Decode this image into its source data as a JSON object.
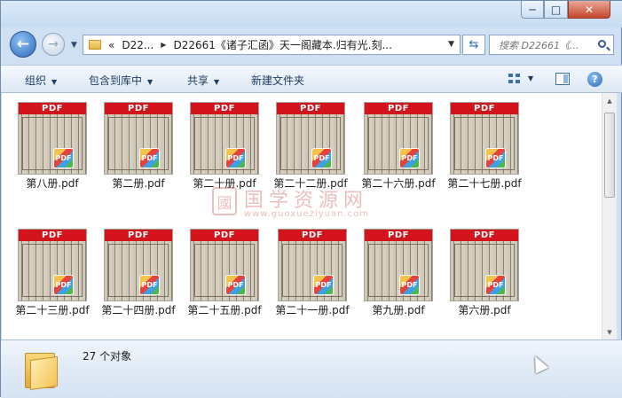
{
  "window": {
    "minimize_label": "─",
    "maximize_label": "□",
    "close_label": "✕"
  },
  "nav": {
    "back_glyph": "←",
    "forward_glyph": "→",
    "address": {
      "overflow": "«",
      "segment1": "D22...",
      "segment2": "D22661《诸子汇函》天一阁藏本.归有光.刻..."
    },
    "search": {
      "placeholder": "搜索 D22661《..."
    }
  },
  "toolbar": {
    "organize": "组织",
    "include_in_library": "包含到库中",
    "share": "共享",
    "new_folder": "新建文件夹"
  },
  "files": [
    {
      "name": "第八册.pdf"
    },
    {
      "name": "第二册.pdf"
    },
    {
      "name": "第二十册.pdf"
    },
    {
      "name": "第二十二册.pdf"
    },
    {
      "name": "第二十六册.pdf"
    },
    {
      "name": "第二十七册.pdf"
    },
    {
      "name": "第二十三册.pdf"
    },
    {
      "name": "第二十四册.pdf"
    },
    {
      "name": "第二十五册.pdf"
    },
    {
      "name": "第二十一册.pdf"
    },
    {
      "name": "第九册.pdf"
    },
    {
      "name": "第六册.pdf"
    }
  ],
  "thumb_banner": "PDF",
  "badge_text": "PDF",
  "watermark": {
    "seal": "國",
    "title": "国学资源网",
    "url": "www.guoxueziyuan.com"
  },
  "status": {
    "count_text": "27 个对象"
  },
  "colors": {
    "pdf_banner": "#d3141c",
    "toolbar_text": "#1e3c63",
    "window_frame": "#cfe0f2"
  }
}
